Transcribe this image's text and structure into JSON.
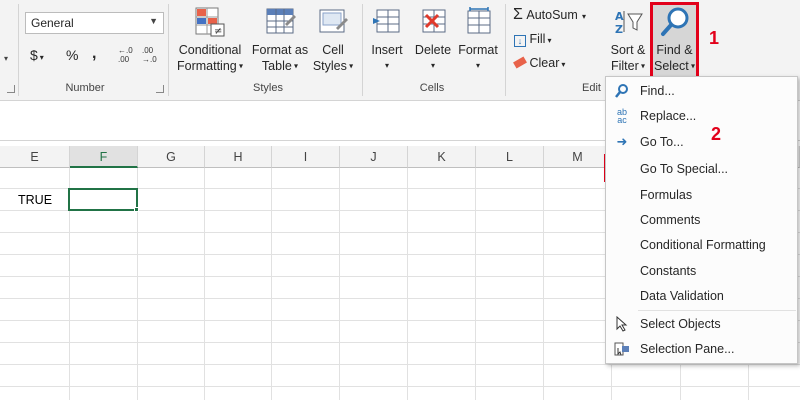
{
  "ribbon": {
    "number_format": "General",
    "currency_symbol": "$",
    "percent_symbol": "%",
    "comma_symbol": ",",
    "group_number": "Number",
    "conditional_formatting": [
      "Conditional",
      "Formatting"
    ],
    "format_as_table": [
      "Format as",
      "Table"
    ],
    "cell_styles": [
      "Cell",
      "Styles"
    ],
    "group_styles": "Styles",
    "insert": "Insert",
    "delete": "Delete",
    "format": "Format",
    "group_cells": "Cells",
    "autosum": "AutoSum",
    "fill": "Fill",
    "clear": "Clear",
    "group_editing_partial": "Edit",
    "sort_filter": [
      "Sort &",
      "Filter"
    ],
    "find_select": [
      "Find &",
      "Select"
    ]
  },
  "annotations": {
    "step1": "1",
    "step2": "2"
  },
  "sheet": {
    "columns": [
      "E",
      "F",
      "G",
      "H",
      "I",
      "J",
      "K",
      "L",
      "M"
    ],
    "active_column": "F",
    "cell_e_value": "TRUE"
  },
  "menu": {
    "items": [
      {
        "label": "Find...",
        "icon": "binoculars-icon"
      },
      {
        "label": "Replace...",
        "icon": "replace-icon"
      },
      {
        "label": "Go To...",
        "icon": "arrow-right-icon"
      },
      {
        "label": "Go To Special...",
        "icon": ""
      },
      {
        "label": "Formulas",
        "icon": ""
      },
      {
        "label": "Comments",
        "icon": ""
      },
      {
        "label": "Conditional Formatting",
        "icon": ""
      },
      {
        "label": "Constants",
        "icon": ""
      },
      {
        "label": "Data Validation",
        "icon": ""
      },
      {
        "label": "Select Objects",
        "icon": "select-cursor-icon"
      },
      {
        "label": "Selection Pane...",
        "icon": "selection-pane-icon"
      }
    ]
  },
  "colors": {
    "highlight": "#e2001a",
    "excel_green": "#217346"
  }
}
